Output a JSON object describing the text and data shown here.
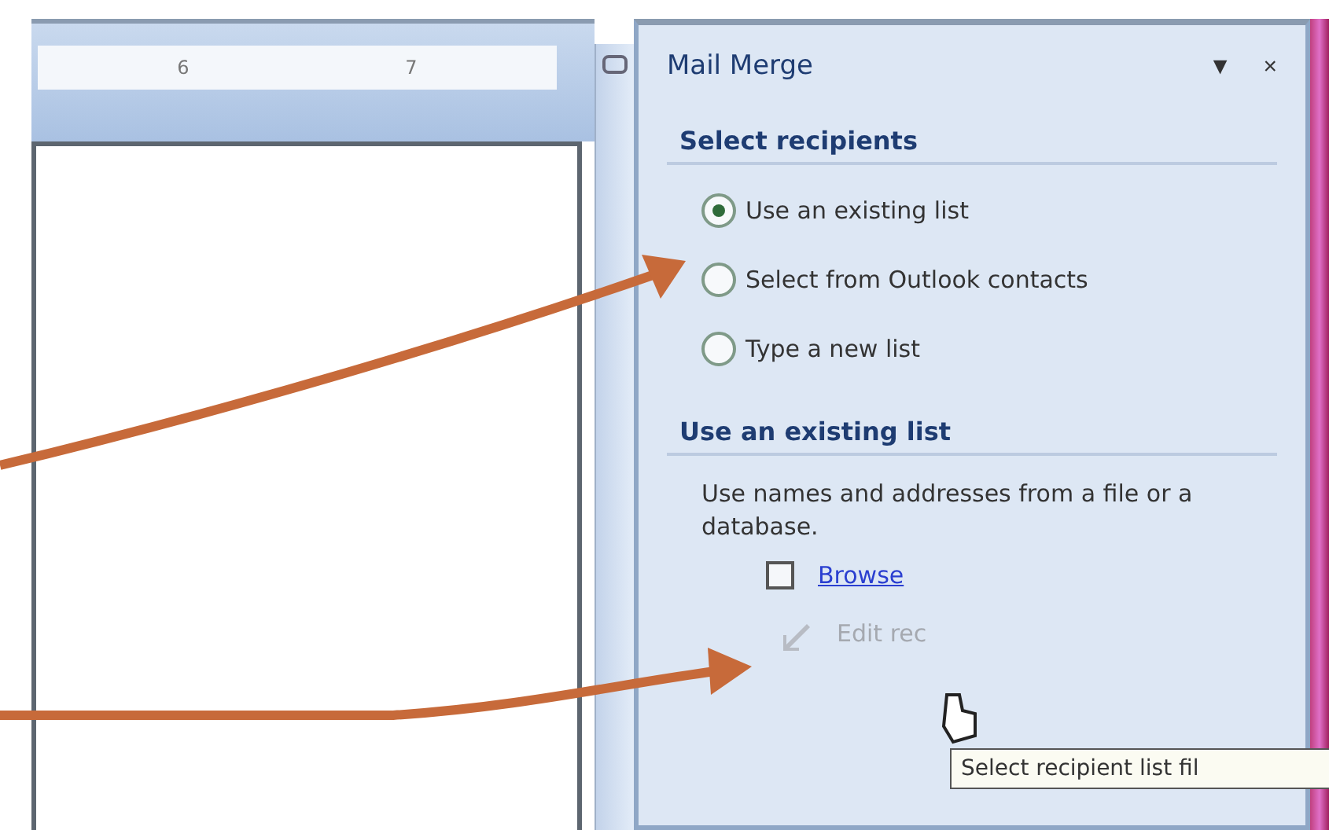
{
  "ruler": {
    "labels": [
      "6",
      "7"
    ]
  },
  "task_pane": {
    "title": "Mail Merge",
    "menu_glyph": "▼",
    "close_glyph": "×",
    "select_recipients": {
      "heading": "Select recipients",
      "options": [
        {
          "label": "Use an existing list",
          "selected": true
        },
        {
          "label": "Select from Outlook contacts",
          "selected": false
        },
        {
          "label": "Type a new list",
          "selected": false
        }
      ]
    },
    "existing_list": {
      "heading": "Use an existing list",
      "description": "Use names and addresses from a file or a database.",
      "actions": [
        {
          "kind": "browse",
          "label": "Browse",
          "disabled": false
        },
        {
          "kind": "edit",
          "label": "Edit rec",
          "disabled": true
        }
      ]
    }
  },
  "tooltip": {
    "text": "Select recipient list fil"
  }
}
